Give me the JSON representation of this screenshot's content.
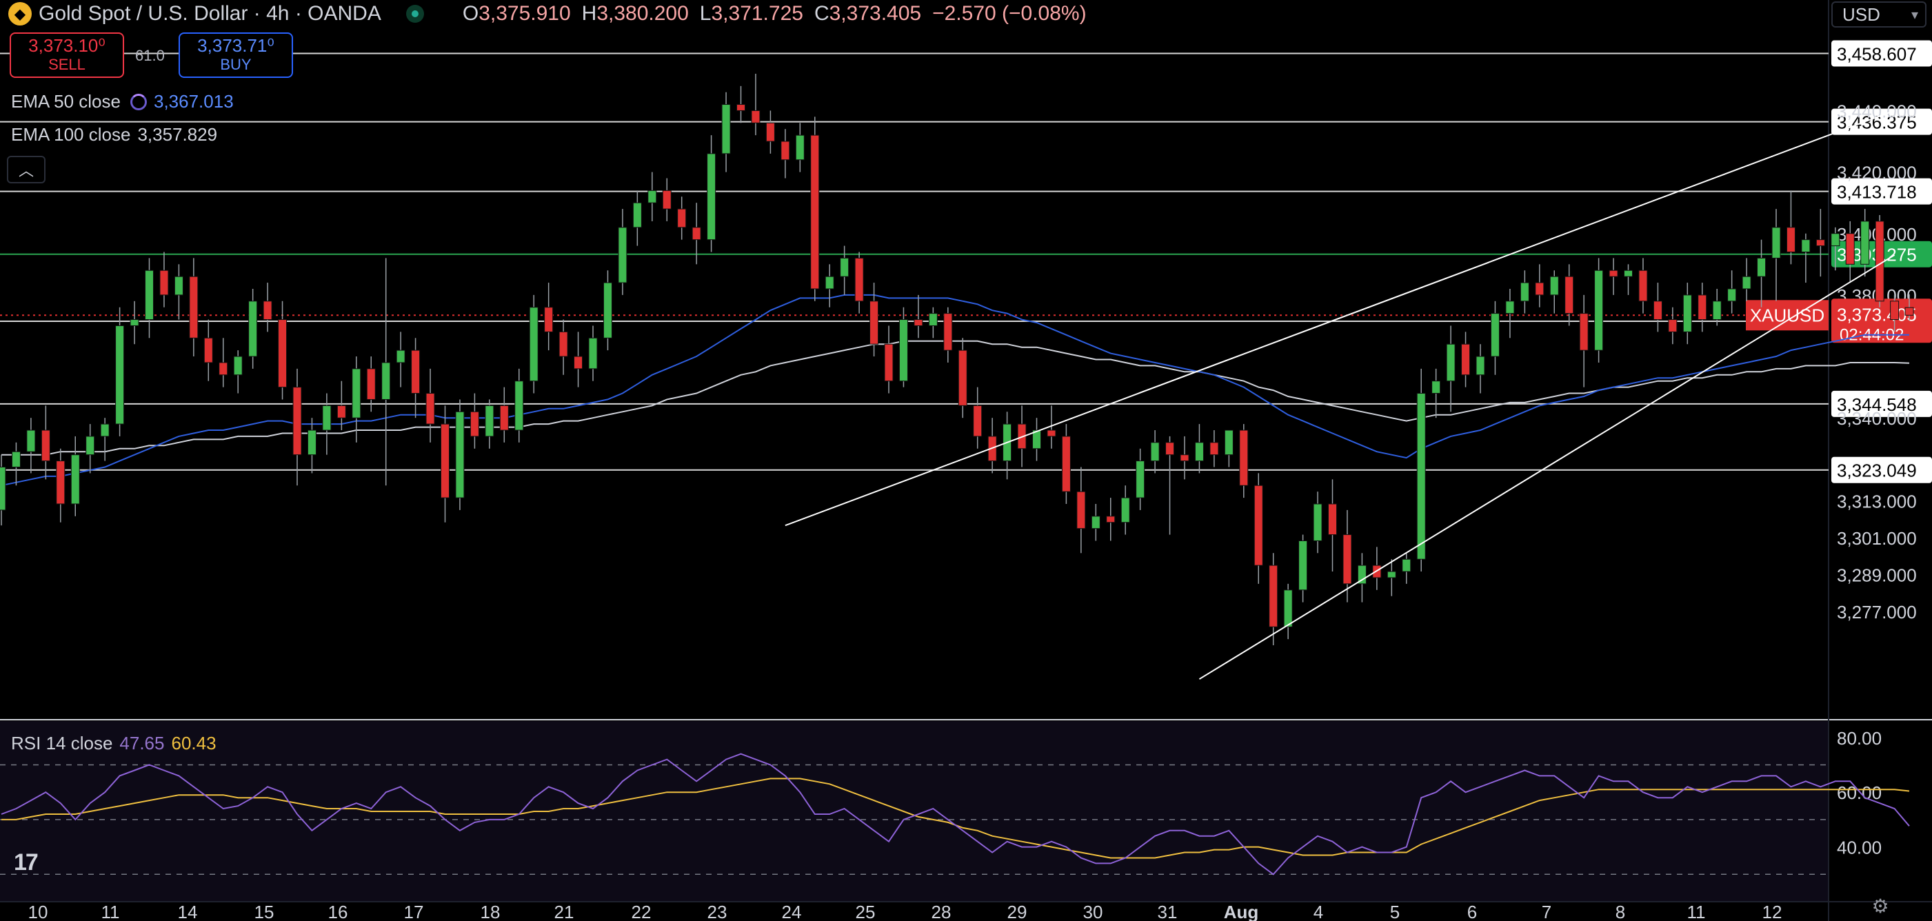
{
  "header": {
    "symbol_title": "Gold Spot / U.S. Dollar · 4h · OANDA",
    "ohlc": {
      "o_label": "O",
      "o_value": "3,375.910",
      "h_label": "H",
      "h_value": "3,380.200",
      "l_label": "L",
      "l_value": "3,371.725",
      "c_label": "C",
      "c_value": "3,373.405",
      "change": "−2.570 (−0.08%)"
    },
    "currency": "USD"
  },
  "trade": {
    "sell_price": "3,373.10⁰",
    "sell_label": "SELL",
    "spread": "61.0",
    "buy_price": "3,373.71⁰",
    "buy_label": "BUY"
  },
  "legends": {
    "ema50_label": "EMA 50 close",
    "ema50_value": "3,367.013",
    "ema100_label": "EMA 100 close",
    "ema100_value": "3,357.829",
    "collapse_icon": "chevron-up-icon",
    "rsi_label": "RSI 14 close",
    "rsi_value": "47.65",
    "rsi_ma_value": "60.43"
  },
  "colors": {
    "up": "#3fb950",
    "down": "#e03030",
    "ema50": "#2f5fe0",
    "ema100": "#d1d4dc",
    "rsi": "#8e63d8",
    "rsi_ma": "#f0c040",
    "current_price_bg": "#e03030",
    "green_level_bg": "#22ab50"
  },
  "chart_data": {
    "type": "candlestick",
    "symbol": "XAUUSD",
    "timeframe": "4h",
    "current_price": "3,373.405",
    "countdown": "02:44:02",
    "price_axis_ticks": [
      "3,440.000",
      "3,420.000",
      "3,400.000",
      "3,380.000",
      "3,340.000",
      "3,313.000",
      "3,301.000",
      "3,289.000",
      "3,277.000"
    ],
    "horizontal_levels": [
      {
        "price": 3458.607,
        "label": "3,458.607",
        "style": "white"
      },
      {
        "price": 3436.375,
        "label": "3,436.375",
        "style": "white"
      },
      {
        "price": 3413.718,
        "label": "3,413.718",
        "style": "white"
      },
      {
        "price": 3393.275,
        "label": "3,393.275",
        "style": "green"
      },
      {
        "price": 3371.463,
        "label": "3,371.463",
        "style": "white"
      },
      {
        "price": 3344.548,
        "label": "3,344.548",
        "style": "white"
      },
      {
        "price": 3323.049,
        "label": "3,323.049",
        "style": "white"
      }
    ],
    "time_axis_labels": [
      "10",
      "11",
      "14",
      "15",
      "16",
      "17",
      "18",
      "21",
      "22",
      "23",
      "24",
      "25",
      "28",
      "29",
      "30",
      "31",
      "Aug",
      "4",
      "5",
      "6",
      "7",
      "8",
      "11",
      "12"
    ],
    "ohlc": [
      [
        3310,
        3328,
        3305,
        3324
      ],
      [
        3324,
        3332,
        3318,
        3329
      ],
      [
        3329,
        3340,
        3322,
        3336
      ],
      [
        3336,
        3344,
        3320,
        3326
      ],
      [
        3326,
        3330,
        3306,
        3312
      ],
      [
        3312,
        3334,
        3308,
        3328
      ],
      [
        3328,
        3338,
        3322,
        3334
      ],
      [
        3334,
        3340,
        3326,
        3338
      ],
      [
        3338,
        3376,
        3334,
        3370
      ],
      [
        3370,
        3378,
        3364,
        3372
      ],
      [
        3372,
        3392,
        3366,
        3388
      ],
      [
        3388,
        3394,
        3376,
        3380
      ],
      [
        3380,
        3390,
        3372,
        3386
      ],
      [
        3386,
        3392,
        3360,
        3366
      ],
      [
        3366,
        3372,
        3352,
        3358
      ],
      [
        3358,
        3366,
        3350,
        3354
      ],
      [
        3354,
        3362,
        3348,
        3360
      ],
      [
        3360,
        3382,
        3356,
        3378
      ],
      [
        3378,
        3384,
        3368,
        3372
      ],
      [
        3372,
        3378,
        3346,
        3350
      ],
      [
        3350,
        3356,
        3318,
        3328
      ],
      [
        3328,
        3340,
        3322,
        3336
      ],
      [
        3336,
        3348,
        3328,
        3344
      ],
      [
        3344,
        3352,
        3336,
        3340
      ],
      [
        3340,
        3360,
        3332,
        3356
      ],
      [
        3356,
        3360,
        3342,
        3346
      ],
      [
        3346,
        3392,
        3318,
        3358
      ],
      [
        3358,
        3368,
        3350,
        3362
      ],
      [
        3362,
        3366,
        3340,
        3348
      ],
      [
        3348,
        3356,
        3332,
        3338
      ],
      [
        3338,
        3344,
        3306,
        3314
      ],
      [
        3314,
        3346,
        3310,
        3342
      ],
      [
        3342,
        3348,
        3330,
        3334
      ],
      [
        3334,
        3346,
        3330,
        3344
      ],
      [
        3344,
        3350,
        3332,
        3336
      ],
      [
        3336,
        3356,
        3332,
        3352
      ],
      [
        3352,
        3380,
        3348,
        3376
      ],
      [
        3376,
        3384,
        3362,
        3368
      ],
      [
        3368,
        3372,
        3354,
        3360
      ],
      [
        3360,
        3368,
        3350,
        3356
      ],
      [
        3356,
        3370,
        3352,
        3366
      ],
      [
        3366,
        3388,
        3362,
        3384
      ],
      [
        3384,
        3408,
        3380,
        3402
      ],
      [
        3402,
        3414,
        3396,
        3410
      ],
      [
        3410,
        3420,
        3404,
        3414
      ],
      [
        3414,
        3418,
        3404,
        3408
      ],
      [
        3408,
        3412,
        3398,
        3402
      ],
      [
        3402,
        3410,
        3390,
        3398
      ],
      [
        3398,
        3432,
        3394,
        3426
      ],
      [
        3426,
        3446,
        3420,
        3442
      ],
      [
        3442,
        3448,
        3436,
        3440
      ],
      [
        3440,
        3452,
        3432,
        3436
      ],
      [
        3436,
        3440,
        3426,
        3430
      ],
      [
        3430,
        3434,
        3418,
        3424
      ],
      [
        3424,
        3436,
        3420,
        3432
      ],
      [
        3432,
        3438,
        3378,
        3382
      ],
      [
        3382,
        3390,
        3376,
        3386
      ],
      [
        3386,
        3396,
        3380,
        3392
      ],
      [
        3392,
        3394,
        3374,
        3378
      ],
      [
        3378,
        3384,
        3360,
        3364
      ],
      [
        3364,
        3370,
        3348,
        3352
      ],
      [
        3352,
        3376,
        3350,
        3372
      ],
      [
        3372,
        3380,
        3366,
        3370
      ],
      [
        3370,
        3376,
        3366,
        3374
      ],
      [
        3374,
        3376,
        3358,
        3362
      ],
      [
        3362,
        3366,
        3340,
        3344
      ],
      [
        3344,
        3350,
        3330,
        3334
      ],
      [
        3334,
        3340,
        3322,
        3326
      ],
      [
        3326,
        3342,
        3320,
        3338
      ],
      [
        3338,
        3344,
        3324,
        3330
      ],
      [
        3330,
        3340,
        3326,
        3336
      ],
      [
        3336,
        3344,
        3330,
        3334
      ],
      [
        3334,
        3338,
        3312,
        3316
      ],
      [
        3316,
        3324,
        3296,
        3304
      ],
      [
        3304,
        3312,
        3300,
        3308
      ],
      [
        3308,
        3314,
        3300,
        3306
      ],
      [
        3306,
        3318,
        3302,
        3314
      ],
      [
        3314,
        3330,
        3310,
        3326
      ],
      [
        3326,
        3336,
        3322,
        3332
      ],
      [
        3332,
        3334,
        3302,
        3328
      ],
      [
        3328,
        3334,
        3320,
        3326
      ],
      [
        3326,
        3338,
        3322,
        3332
      ],
      [
        3332,
        3336,
        3324,
        3328
      ],
      [
        3328,
        3330,
        3324,
        3336
      ],
      [
        3336,
        3338,
        3314,
        3318
      ],
      [
        3318,
        3322,
        3286,
        3292
      ],
      [
        3292,
        3296,
        3266,
        3272
      ],
      [
        3272,
        3286,
        3268,
        3284
      ],
      [
        3284,
        3302,
        3280,
        3300
      ],
      [
        3300,
        3316,
        3296,
        3312
      ],
      [
        3312,
        3320,
        3290,
        3302
      ],
      [
        3302,
        3310,
        3280,
        3286
      ],
      [
        3286,
        3296,
        3280,
        3292
      ],
      [
        3292,
        3298,
        3284,
        3288
      ],
      [
        3288,
        3294,
        3282,
        3290
      ],
      [
        3290,
        3296,
        3286,
        3294
      ],
      [
        3294,
        3356,
        3290,
        3348
      ],
      [
        3348,
        3356,
        3340,
        3352
      ],
      [
        3352,
        3370,
        3342,
        3364
      ],
      [
        3364,
        3368,
        3350,
        3354
      ],
      [
        3354,
        3364,
        3348,
        3360
      ],
      [
        3360,
        3378,
        3354,
        3374
      ],
      [
        3374,
        3382,
        3366,
        3378
      ],
      [
        3378,
        3388,
        3374,
        3384
      ],
      [
        3384,
        3390,
        3376,
        3380
      ],
      [
        3380,
        3388,
        3374,
        3386
      ],
      [
        3386,
        3390,
        3370,
        3374
      ],
      [
        3374,
        3380,
        3350,
        3362
      ],
      [
        3362,
        3392,
        3358,
        3388
      ],
      [
        3388,
        3392,
        3380,
        3386
      ],
      [
        3386,
        3390,
        3380,
        3388
      ],
      [
        3388,
        3392,
        3374,
        3378
      ],
      [
        3378,
        3384,
        3368,
        3372
      ],
      [
        3372,
        3376,
        3364,
        3368
      ],
      [
        3368,
        3384,
        3364,
        3380
      ],
      [
        3380,
        3384,
        3368,
        3372
      ],
      [
        3372,
        3382,
        3370,
        3378
      ],
      [
        3378,
        3388,
        3374,
        3382
      ],
      [
        3382,
        3392,
        3378,
        3386
      ],
      [
        3386,
        3398,
        3376,
        3392
      ],
      [
        3392,
        3408,
        3378,
        3402
      ],
      [
        3402,
        3414,
        3390,
        3394
      ],
      [
        3394,
        3400,
        3384,
        3398
      ],
      [
        3398,
        3408,
        3386,
        3396
      ],
      [
        3396,
        3402,
        3388,
        3400
      ],
      [
        3400,
        3404,
        3384,
        3390
      ],
      [
        3390,
        3408,
        3386,
        3404
      ],
      [
        3404,
        3406,
        3376,
        3378
      ],
      [
        3378,
        3380,
        3368,
        3372
      ],
      [
        3375.91,
        3380.2,
        3371.725,
        3373.405
      ]
    ],
    "ema50": [
      3318,
      3319,
      3320,
      3321,
      3321,
      3322,
      3323,
      3324,
      3326,
      3328,
      3330,
      3332,
      3334,
      3335,
      3336,
      3336,
      3337,
      3338,
      3339,
      3339,
      3338,
      3338,
      3338,
      3338,
      3339,
      3339,
      3340,
      3341,
      3341,
      3341,
      3340,
      3340,
      3340,
      3340,
      3340,
      3341,
      3342,
      3343,
      3343,
      3344,
      3345,
      3346,
      3348,
      3351,
      3354,
      3356,
      3358,
      3360,
      3363,
      3366,
      3369,
      3372,
      3375,
      3377,
      3379,
      3379,
      3379,
      3380,
      3380,
      3380,
      3379,
      3379,
      3379,
      3379,
      3379,
      3378,
      3377,
      3375,
      3374,
      3372,
      3371,
      3369,
      3367,
      3365,
      3363,
      3361,
      3360,
      3359,
      3358,
      3357,
      3356,
      3355,
      3354,
      3352,
      3350,
      3347,
      3344,
      3341,
      3339,
      3337,
      3335,
      3333,
      3331,
      3329,
      3328,
      3327,
      3330,
      3332,
      3334,
      3335,
      3336,
      3338,
      3340,
      3342,
      3344,
      3345,
      3346,
      3347,
      3349,
      3350,
      3351,
      3352,
      3353,
      3353,
      3354,
      3355,
      3356,
      3357,
      3358,
      3359,
      3360,
      3362,
      3363,
      3364,
      3365,
      3366,
      3367,
      3367,
      3367,
      3367.013
    ],
    "ema100": [
      3328,
      3328,
      3328,
      3328,
      3329,
      3329,
      3329,
      3329,
      3330,
      3330,
      3331,
      3331,
      3332,
      3333,
      3333,
      3333,
      3334,
      3334,
      3334,
      3335,
      3335,
      3335,
      3335,
      3335,
      3336,
      3336,
      3336,
      3336,
      3337,
      3337,
      3337,
      3337,
      3337,
      3337,
      3337,
      3337,
      3338,
      3338,
      3339,
      3339,
      3340,
      3341,
      3342,
      3343,
      3344,
      3346,
      3347,
      3348,
      3350,
      3352,
      3354,
      3355,
      3357,
      3358,
      3359,
      3360,
      3361,
      3362,
      3363,
      3364,
      3364,
      3365,
      3365,
      3365,
      3365,
      3365,
      3365,
      3364,
      3364,
      3363,
      3363,
      3362,
      3361,
      3360,
      3359,
      3359,
      3358,
      3357,
      3357,
      3356,
      3355,
      3355,
      3354,
      3353,
      3352,
      3350,
      3349,
      3347,
      3346,
      3345,
      3344,
      3343,
      3342,
      3341,
      3340,
      3339,
      3340,
      3341,
      3341,
      3342,
      3343,
      3344,
      3345,
      3345,
      3346,
      3347,
      3348,
      3348,
      3349,
      3350,
      3350,
      3351,
      3352,
      3352,
      3353,
      3353,
      3354,
      3354,
      3355,
      3355,
      3356,
      3356,
      3357,
      3357,
      3357,
      3358,
      3358,
      3358,
      3358,
      3357.829
    ],
    "trendlines": [
      {
        "from": [
          53,
          3305
        ],
        "to": [
          128,
          3440
        ]
      },
      {
        "from": [
          81,
          3255
        ],
        "to": [
          128,
          3393
        ]
      }
    ],
    "rsi_axis_ticks": [
      "80.00",
      "60.00",
      "40.00"
    ],
    "rsi_bands": {
      "upper": 70,
      "middle": 50,
      "lower": 30
    },
    "rsi": [
      52,
      54,
      57,
      60,
      56,
      50,
      56,
      60,
      66,
      68,
      70,
      68,
      66,
      62,
      58,
      54,
      55,
      58,
      62,
      60,
      52,
      46,
      50,
      54,
      56,
      54,
      60,
      62,
      58,
      55,
      50,
      46,
      49,
      50,
      50,
      52,
      58,
      62,
      60,
      56,
      54,
      58,
      64,
      68,
      70,
      72,
      68,
      64,
      68,
      72,
      74,
      72,
      70,
      66,
      60,
      52,
      52,
      54,
      50,
      46,
      42,
      50,
      52,
      54,
      50,
      46,
      42,
      38,
      42,
      40,
      40,
      42,
      40,
      36,
      34,
      34,
      36,
      40,
      44,
      46,
      46,
      44,
      44,
      46,
      40,
      34,
      30,
      36,
      40,
      44,
      42,
      38,
      40,
      38,
      38,
      40,
      58,
      60,
      64,
      60,
      62,
      64,
      66,
      68,
      66,
      66,
      62,
      58,
      66,
      64,
      64,
      60,
      58,
      58,
      62,
      60,
      62,
      64,
      64,
      66,
      66,
      62,
      64,
      62,
      64,
      64,
      58,
      56,
      54,
      47.65
    ],
    "rsi_ma": [
      50,
      50,
      51,
      52,
      52,
      52,
      53,
      54,
      55,
      56,
      57,
      58,
      59,
      59,
      59,
      59,
      58,
      58,
      58,
      57,
      56,
      55,
      54,
      54,
      54,
      53,
      53,
      53,
      53,
      53,
      52,
      52,
      52,
      52,
      52,
      52,
      53,
      53,
      54,
      54,
      55,
      56,
      57,
      58,
      59,
      60,
      60,
      60,
      61,
      62,
      63,
      64,
      65,
      65,
      65,
      64,
      63,
      61,
      59,
      57,
      55,
      53,
      51,
      50,
      49,
      47,
      46,
      44,
      43,
      42,
      41,
      40,
      39,
      38,
      37,
      36,
      36,
      36,
      36,
      37,
      38,
      38,
      39,
      39,
      40,
      40,
      39,
      38,
      37,
      37,
      37,
      38,
      38,
      38,
      38,
      38,
      41,
      43,
      45,
      47,
      49,
      51,
      53,
      55,
      57,
      58,
      59,
      60,
      61,
      61,
      61,
      61,
      61,
      61,
      61,
      61,
      61,
      61,
      61,
      61,
      61,
      61,
      61,
      61,
      61,
      61,
      61,
      61,
      61,
      60.43
    ]
  }
}
